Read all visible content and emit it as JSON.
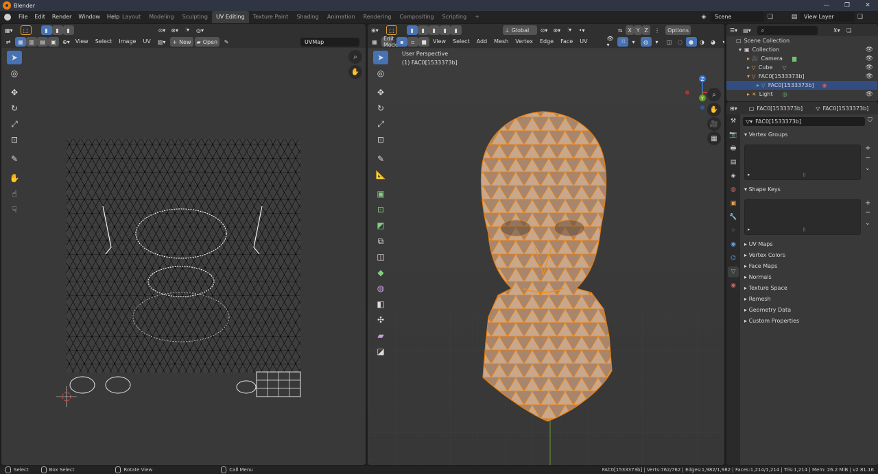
{
  "window": {
    "title": "Blender"
  },
  "menu": {
    "items": [
      "File",
      "Edit",
      "Render",
      "Window",
      "Help"
    ]
  },
  "workspaces": {
    "tabs": [
      "Layout",
      "Modeling",
      "Sculpting",
      "UV Editing",
      "Texture Paint",
      "Shading",
      "Animation",
      "Rendering",
      "Compositing",
      "Scripting"
    ],
    "active": "UV Editing",
    "add_label": "+"
  },
  "scene": {
    "name": "Scene",
    "view_layer": "View Layer"
  },
  "uv_editor": {
    "menus": [
      "View",
      "Select",
      "Image",
      "UV"
    ],
    "new_label": "New",
    "open_label": "Open",
    "uvmap": "UVMap"
  },
  "viewport": {
    "mode": "Edit Mode",
    "menus": [
      "View",
      "Select",
      "Add",
      "Mesh",
      "Vertex",
      "Edge",
      "Face",
      "UV"
    ],
    "orientation": "Global",
    "options_label": "Options",
    "overlay_title": "User Perspective",
    "overlay_object": "(1) FAC0[1533373b]",
    "axes": [
      "X",
      "Y",
      "Z"
    ],
    "gizmo_labels": {
      "x": "X",
      "y": "Y",
      "z": "Z"
    }
  },
  "outliner": {
    "search_placeholder": "",
    "rows": [
      {
        "label": "Scene Collection",
        "indent": 0
      },
      {
        "label": "Collection",
        "indent": 1
      },
      {
        "label": "Camera",
        "indent": 2
      },
      {
        "label": "Cube",
        "indent": 2
      },
      {
        "label": "FAC0[1533373b]",
        "indent": 2
      },
      {
        "label": "FAC0[1533373b]",
        "indent": 3
      },
      {
        "label": "Light",
        "indent": 2
      }
    ]
  },
  "properties": {
    "object_name": "FAC0[1533373b]",
    "mesh_name": "FAC0[1533373b]",
    "data_field": "FAC0[1533373b]",
    "panels": {
      "vertex_groups": "Vertex Groups",
      "shape_keys": "Shape Keys",
      "collapsed": [
        "UV Maps",
        "Vertex Colors",
        "Face Maps",
        "Normals",
        "Texture Space",
        "Remesh",
        "Geometry Data",
        "Custom Properties"
      ]
    }
  },
  "statusbar": {
    "select": "Select",
    "box_select": "Box Select",
    "rotate_view": "Rotate View",
    "call_menu": "Call Menu",
    "stats": "FAC0[1533373b] | Verts:762/762 | Edges:1,982/1,982 | Faces:1,214/1,214 | Tris:1,214 | Mem: 26.2 MiB | v2.81.16"
  },
  "colors": {
    "accent": "#4772b3",
    "selection": "#e87d0d",
    "mesh_face": "#c9a78a"
  }
}
